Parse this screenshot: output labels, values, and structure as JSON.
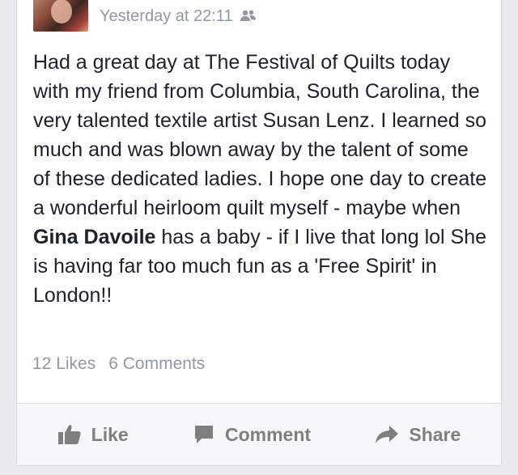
{
  "post": {
    "timestamp": "Yesterday at 22:11",
    "audience_icon": "friends-icon",
    "text_before": "Had a great day at The Festival of Quilts today with my friend from Columbia, South Carolina, the very talented textile artist Susan Lenz. I learned so much and was blown away by the talent of some of these dedicated ladies. I hope one day to create a wonderful heirloom quilt myself - maybe when ",
    "mention": "Gina Davoile",
    "text_after": " has a baby - if I live that long lol She is having far too much fun as a 'Free Spirit' in London!!"
  },
  "stats": {
    "likes": "12 Likes",
    "comments": "6 Comments"
  },
  "actions": {
    "like_label": "Like",
    "comment_label": "Comment",
    "share_label": "Share"
  },
  "colors": {
    "text": "#1d2129",
    "meta": "#9197a3",
    "action": "#7f7f7f",
    "background": "#e9eaed"
  }
}
